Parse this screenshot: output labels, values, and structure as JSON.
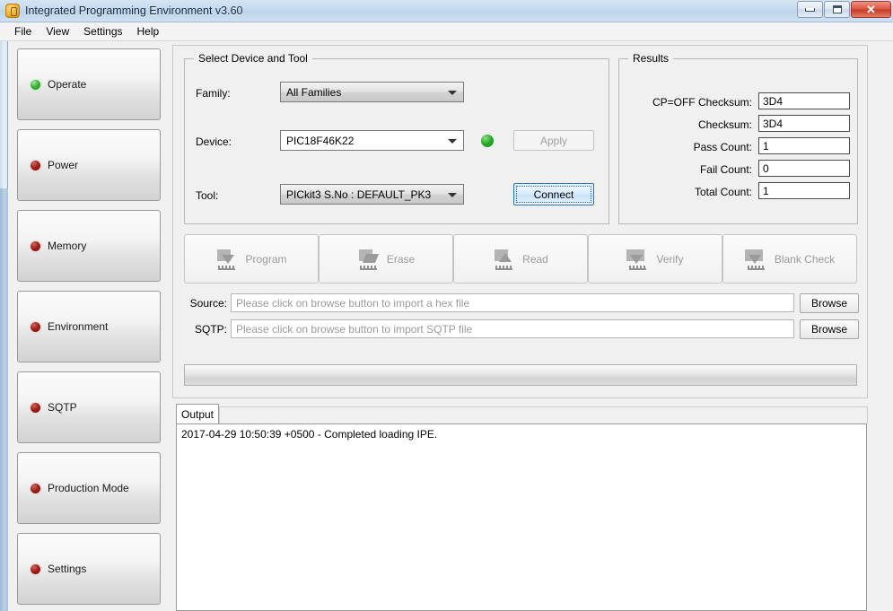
{
  "window": {
    "title": "Integrated Programming Environment v3.60",
    "icon": "app-icon",
    "minimize": "minimize-icon",
    "maximize": "maximize-icon",
    "close": "✕"
  },
  "menu": {
    "items": [
      "File",
      "View",
      "Settings",
      "Help"
    ]
  },
  "sidebar": {
    "items": [
      {
        "label": "Operate",
        "led": "green"
      },
      {
        "label": "Power",
        "led": "red"
      },
      {
        "label": "Memory",
        "led": "red"
      },
      {
        "label": "Environment",
        "led": "red"
      },
      {
        "label": "SQTP",
        "led": "red"
      },
      {
        "label": "Production Mode",
        "led": "red"
      },
      {
        "label": "Settings",
        "led": "red"
      }
    ]
  },
  "device_group": {
    "title": "Select Device and Tool",
    "family_label": "Family:",
    "family_value": "All Families",
    "device_label": "Device:",
    "device_value": "PIC18F46K22",
    "tool_label": "Tool:",
    "tool_value": "PICkit3 S.No : DEFAULT_PK3",
    "apply_label": "Apply",
    "connect_label": "Connect",
    "status_led": "green"
  },
  "results_group": {
    "title": "Results",
    "rows": [
      {
        "label": "CP=OFF Checksum:",
        "value": "3D4"
      },
      {
        "label": "Checksum:",
        "value": "3D4"
      },
      {
        "label": "Pass Count:",
        "value": "1"
      },
      {
        "label": "Fail Count:",
        "value": "0"
      },
      {
        "label": "Total Count:",
        "value": "1"
      }
    ]
  },
  "actions": [
    {
      "label": "Program",
      "icon": "chip-download-icon"
    },
    {
      "label": "Erase",
      "icon": "chip-erase-icon"
    },
    {
      "label": "Read",
      "icon": "chip-upload-icon"
    },
    {
      "label": "Verify",
      "icon": "chip-verify-icon"
    },
    {
      "label": "Blank Check",
      "icon": "chip-blankcheck-icon"
    }
  ],
  "files": {
    "source_label": "Source:",
    "source_placeholder": "Please click on browse button to import a hex file",
    "sqtp_label": "SQTP:",
    "sqtp_placeholder": "Please click on browse button to import SQTP file",
    "browse_label": "Browse"
  },
  "progress": {
    "value": 0
  },
  "output": {
    "tab_label": "Output",
    "lines": [
      "2017-04-29 10:50:39 +0500 - Completed loading IPE."
    ]
  },
  "colors": {
    "led_green": "#2aa72a",
    "led_red": "#a01d17",
    "accent_blue": "#2f72b5",
    "titlebar": "#c6daee",
    "close_red": "#c43c26"
  }
}
